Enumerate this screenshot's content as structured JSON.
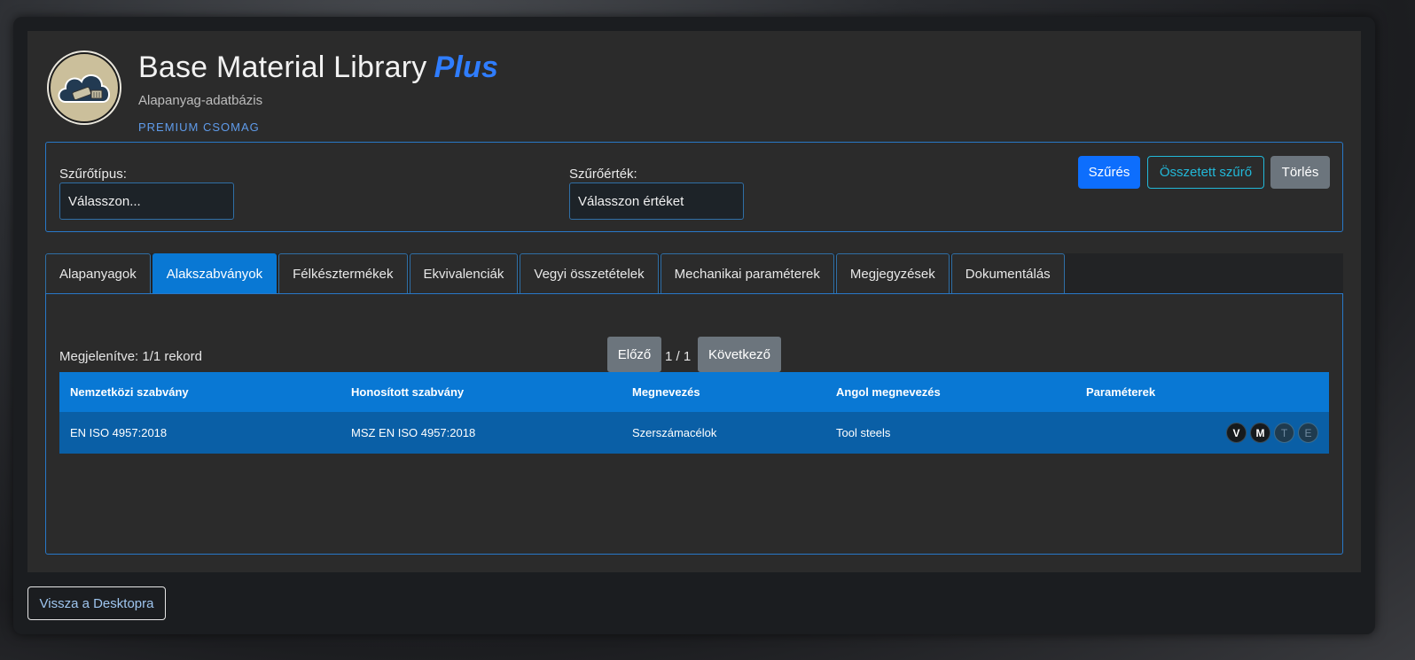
{
  "app": {
    "title": "Base Material Library",
    "title_suffix": "Plus",
    "subtitle": "Alapanyag-adatbázis",
    "package": "PREMIUM CSOMAG"
  },
  "filter": {
    "type_label": "Szűrőtípus:",
    "type_value": "Válasszon...",
    "value_label": "Szűrőérték:",
    "value_value": "Válasszon értéket",
    "filter_button": "Szűrés",
    "complex_button": "Összetett szűrő",
    "clear_button": "Törlés"
  },
  "tabs": [
    {
      "label": "Alapanyagok",
      "active": false
    },
    {
      "label": "Alakszabványok",
      "active": true
    },
    {
      "label": "Félkésztermékek",
      "active": false
    },
    {
      "label": "Ekvivalenciák",
      "active": false
    },
    {
      "label": "Vegyi összetételek",
      "active": false
    },
    {
      "label": "Mechanikai paraméterek",
      "active": false
    },
    {
      "label": "Megjegyzések",
      "active": false
    },
    {
      "label": "Dokumentálás",
      "active": false
    }
  ],
  "pagination": {
    "record_text": "Megjelenítve: 1/1 rekord",
    "prev": "Előző",
    "page": "1 / 1",
    "next": "Következő"
  },
  "table": {
    "headers": [
      "Nemzetközi szabvány",
      "Honosított szabvány",
      "Megnevezés",
      "Angol megnevezés",
      "Paraméterek"
    ],
    "rows": [
      {
        "intl": "EN ISO 4957:2018",
        "local": "MSZ EN ISO 4957:2018",
        "name": "Szerszámacélok",
        "english": "Tool steels",
        "params": [
          "V",
          "M",
          "T",
          "E"
        ]
      }
    ]
  },
  "footer": {
    "back_button": "Vissza a Desktopra"
  },
  "colors": {
    "accent": "#0978d4",
    "primary_button": "#0d6efd",
    "outline_button": "#22b8d8",
    "secondary_button": "#6c757d",
    "plus": "#2f7dff"
  }
}
